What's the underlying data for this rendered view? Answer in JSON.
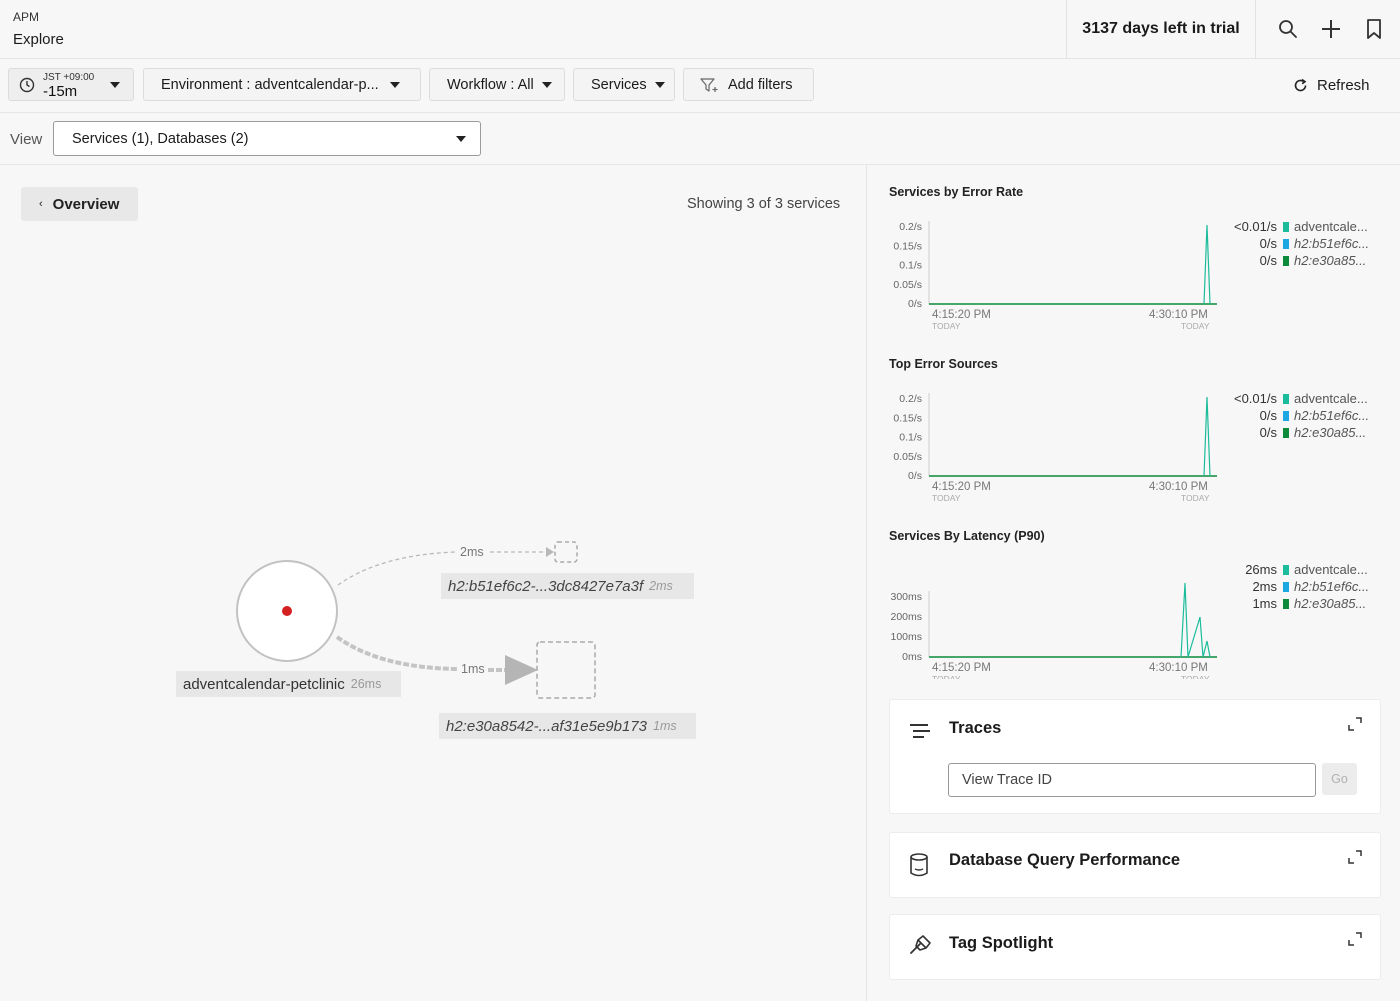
{
  "header": {
    "breadcrumb": "APM",
    "title": "Explore",
    "trial": "3137 days left in trial",
    "icons": [
      "search-icon",
      "plus-icon",
      "bookmark-icon"
    ]
  },
  "filters": {
    "time_zone": "JST +09:00",
    "time_value": "-15m",
    "environment": "Environment : adventcalendar-p...",
    "workflow": "Workflow : All",
    "services": "Services",
    "add_filters": "Add filters",
    "refresh": "Refresh"
  },
  "view": {
    "label": "View",
    "selected": "Services (1), Databases (2)"
  },
  "map": {
    "overview": "Overview",
    "showing": "Showing 3 of 3 services",
    "service_node": {
      "name": "adventcalendar-petclinic",
      "latency": "26ms"
    },
    "db_nodes": [
      {
        "name": "h2:b51ef6c2-...3dc8427e7a3f",
        "latency": "2ms",
        "edge_label": "2ms"
      },
      {
        "name": "h2:e30a8542-...af31e5e9b173",
        "latency": "1ms",
        "edge_label": "1ms"
      }
    ]
  },
  "colors": {
    "teal": "#1bbc9b",
    "blue": "#1aa7e2",
    "dark_green": "#0b8a3a",
    "error_dot": "#d42020"
  },
  "charts": [
    {
      "title": "Services by Error Rate",
      "y_ticks": [
        "0.2/s",
        "0.15/s",
        "0.1/s",
        "0.05/s",
        "0/s"
      ],
      "x_ticks": [
        "4:15:20 PM",
        "4:30:10 PM"
      ],
      "x_sub": [
        "TODAY",
        "TODAY"
      ],
      "legend": [
        {
          "value": "<0.01/s",
          "name": "adventcale...",
          "color": "#1bbc9b",
          "italic": false
        },
        {
          "value": "0/s",
          "name": "h2:b51ef6c...",
          "color": "#1aa7e2",
          "italic": true
        },
        {
          "value": "0/s",
          "name": "h2:e30a85...",
          "color": "#0b8a3a",
          "italic": true
        }
      ]
    },
    {
      "title": "Top Error Sources",
      "y_ticks": [
        "0.2/s",
        "0.15/s",
        "0.1/s",
        "0.05/s",
        "0/s"
      ],
      "x_ticks": [
        "4:15:20 PM",
        "4:30:10 PM"
      ],
      "x_sub": [
        "TODAY",
        "TODAY"
      ],
      "legend": [
        {
          "value": "<0.01/s",
          "name": "adventcale...",
          "color": "#1bbc9b",
          "italic": false
        },
        {
          "value": "0/s",
          "name": "h2:b51ef6c...",
          "color": "#1aa7e2",
          "italic": true
        },
        {
          "value": "0/s",
          "name": "h2:e30a85...",
          "color": "#0b8a3a",
          "italic": true
        }
      ]
    },
    {
      "title": "Services By Latency (P90)",
      "y_ticks": [
        "300ms",
        "200ms",
        "100ms",
        "0ms"
      ],
      "x_ticks": [
        "4:15:20 PM",
        "4:30:10 PM"
      ],
      "x_sub": [
        "TODAY",
        "TODAY"
      ],
      "legend": [
        {
          "value": "26ms",
          "name": "adventcale...",
          "color": "#1bbc9b",
          "italic": false
        },
        {
          "value": "2ms",
          "name": "h2:b51ef6c...",
          "color": "#1aa7e2",
          "italic": true
        },
        {
          "value": "1ms",
          "name": "h2:e30a85...",
          "color": "#0b8a3a",
          "italic": true
        }
      ]
    }
  ],
  "chart_data": [
    {
      "type": "line",
      "title": "Services by Error Rate",
      "ylim": [
        0,
        0.2
      ],
      "x": [
        "4:15:20 PM",
        "4:30:10 PM"
      ],
      "series": [
        {
          "name": "adventcale...",
          "peak": 0.2
        },
        {
          "name": "h2:b51ef6c...",
          "peak": 0
        },
        {
          "name": "h2:e30a85...",
          "peak": 0
        }
      ]
    },
    {
      "type": "line",
      "title": "Top Error Sources",
      "ylim": [
        0,
        0.2
      ],
      "x": [
        "4:15:20 PM",
        "4:30:10 PM"
      ],
      "series": [
        {
          "name": "adventcale...",
          "peak": 0.2
        },
        {
          "name": "h2:b51ef6c...",
          "peak": 0
        },
        {
          "name": "h2:e30a85...",
          "peak": 0
        }
      ]
    },
    {
      "type": "line",
      "title": "Services By Latency (P90)",
      "ylim": [
        0,
        300
      ],
      "x": [
        "4:15:20 PM",
        "4:30:10 PM"
      ],
      "series": [
        {
          "name": "adventcale...",
          "peaks": [
            370,
            200,
            80
          ]
        },
        {
          "name": "h2:b51ef6c...",
          "peak": 0
        },
        {
          "name": "h2:e30a85...",
          "peak": 0
        }
      ]
    }
  ],
  "cards": {
    "traces": {
      "title": "Traces",
      "placeholder": "View Trace ID",
      "go": "Go"
    },
    "db_query": {
      "title": "Database Query Performance"
    },
    "tag_spotlight": {
      "title": "Tag Spotlight"
    }
  }
}
